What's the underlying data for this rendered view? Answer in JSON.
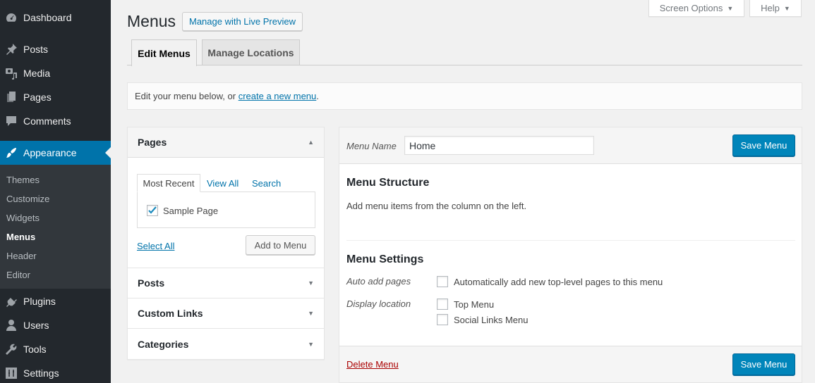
{
  "sidebar": {
    "items": [
      {
        "label": "Dashboard",
        "icon": "dashboard-icon"
      },
      {
        "label": "Posts",
        "icon": "pin-icon"
      },
      {
        "label": "Media",
        "icon": "media-icon"
      },
      {
        "label": "Pages",
        "icon": "pages-icon"
      },
      {
        "label": "Comments",
        "icon": "comment-icon"
      },
      {
        "label": "Appearance",
        "icon": "paintbrush-icon"
      },
      {
        "label": "Plugins",
        "icon": "plugin-icon"
      },
      {
        "label": "Users",
        "icon": "user-icon"
      },
      {
        "label": "Tools",
        "icon": "wrench-icon"
      },
      {
        "label": "Settings",
        "icon": "settings-icon"
      }
    ],
    "submenu": [
      "Themes",
      "Customize",
      "Widgets",
      "Menus",
      "Header",
      "Editor"
    ],
    "current_submenu": "Menus",
    "active_color": "#0073aa"
  },
  "header": {
    "title": "Menus",
    "live_preview_label": "Manage with Live Preview",
    "screen_options_label": "Screen Options",
    "help_label": "Help"
  },
  "tabs": [
    {
      "label": "Edit Menus",
      "active": true
    },
    {
      "label": "Manage Locations",
      "active": false
    }
  ],
  "notice": {
    "text": "Edit your menu below, or ",
    "link": "create a new menu",
    "suffix": "."
  },
  "accordion": {
    "sections": [
      {
        "title": "Pages",
        "open": true
      },
      {
        "title": "Posts",
        "open": false
      },
      {
        "title": "Custom Links",
        "open": false
      },
      {
        "title": "Categories",
        "open": false
      }
    ],
    "inner_tabs": [
      "Most Recent",
      "View All",
      "Search"
    ],
    "items": [
      {
        "label": "Sample Page",
        "checked": true
      }
    ],
    "select_all": "Select All",
    "add_to_menu": "Add to Menu"
  },
  "menu_editor": {
    "menu_name_label": "Menu Name",
    "menu_name_value": "Home",
    "save_label": "Save Menu",
    "structure_title": "Menu Structure",
    "structure_help": "Add menu items from the column on the left.",
    "settings_title": "Menu Settings",
    "auto_add_label": "Auto add pages",
    "auto_add_option": "Automatically add new top-level pages to this menu",
    "display_location_label": "Display location",
    "locations": [
      "Top Menu",
      "Social Links Menu"
    ],
    "delete_label": "Delete Menu",
    "primary_color": "#0085ba",
    "delete_color": "#a00"
  }
}
